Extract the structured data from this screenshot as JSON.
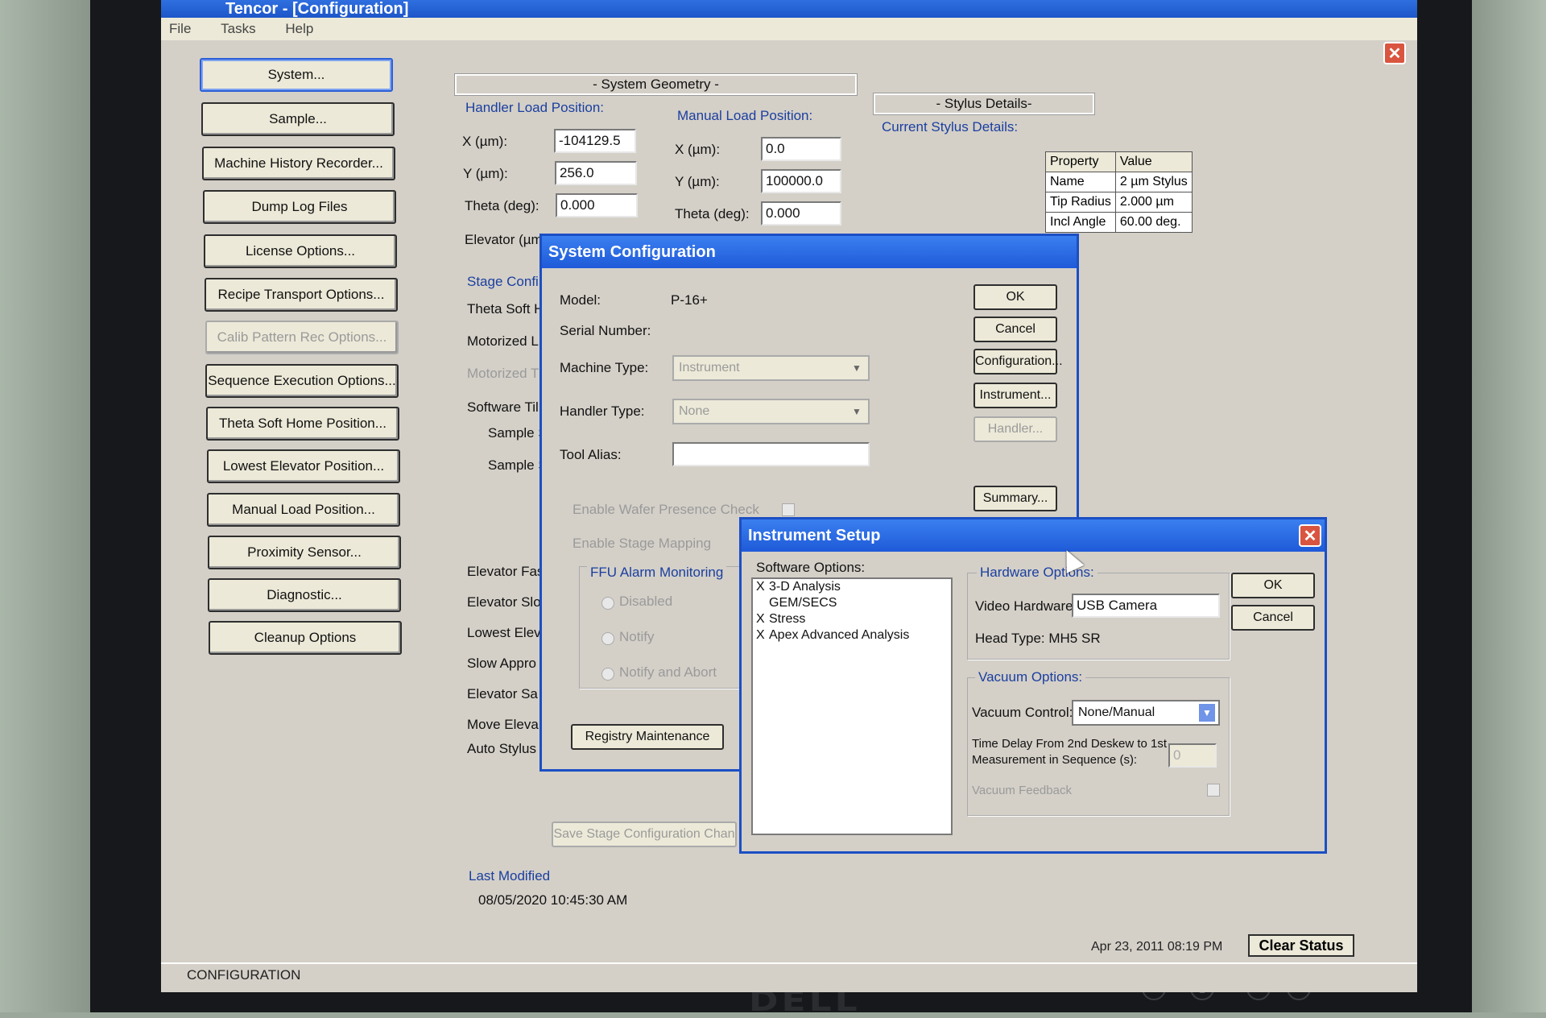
{
  "window": {
    "title": "Tencor - [Configuration]",
    "close": "✕"
  },
  "menu": [
    "File",
    "Tasks",
    "Help"
  ],
  "nav": [
    {
      "label": "System...",
      "state": "active"
    },
    {
      "label": "Sample...",
      "state": "normal"
    },
    {
      "label": "Machine History Recorder...",
      "state": "normal"
    },
    {
      "label": "Dump Log Files",
      "state": "normal"
    },
    {
      "label": "License Options...",
      "state": "normal"
    },
    {
      "label": "Recipe Transport Options...",
      "state": "normal"
    },
    {
      "label": "Calib Pattern Rec Options...",
      "state": "disabled"
    },
    {
      "label": "Sequence Execution Options...",
      "state": "normal"
    },
    {
      "label": "Theta Soft Home Position...",
      "state": "normal"
    },
    {
      "label": "Lowest Elevator Position...",
      "state": "normal"
    },
    {
      "label": "Manual Load Position...",
      "state": "normal"
    },
    {
      "label": "Proximity Sensor...",
      "state": "normal"
    },
    {
      "label": "Diagnostic...",
      "state": "normal"
    },
    {
      "label": "Cleanup Options",
      "state": "normal"
    }
  ],
  "geometry": {
    "title": "- System Geometry -",
    "handler": {
      "title": "Handler Load Position:",
      "x_label": "X (µm):",
      "x": "-104129.5",
      "y_label": "Y (µm):",
      "y": "256.0",
      "theta_label": "Theta (deg):",
      "theta": "0.000",
      "elev_label": "Elevator (µm"
    },
    "manual": {
      "title": "Manual Load Position:",
      "x_label": "X (µm):",
      "x": "0.0",
      "y_label": "Y (µm):",
      "y": "100000.0",
      "theta_label": "Theta (deg):",
      "theta": "0.000"
    }
  },
  "stylus": {
    "title": "- Stylus Details-",
    "current": "Current Stylus Details:",
    "header": [
      "Property",
      "Value"
    ],
    "rows": [
      [
        "Name",
        "2 µm Stylus"
      ],
      [
        "Tip Radius",
        "2.000 µm"
      ],
      [
        "Incl Angle",
        "60.00 deg."
      ]
    ]
  },
  "stage": {
    "title": "Stage Confi",
    "labels": [
      "Theta Soft H",
      "Motorized L",
      "Motorized T",
      "Software Til",
      "Sample S",
      "Sample S",
      "Elevator Fas",
      "Elevator Slo",
      "Lowest Elev",
      "Slow Appro",
      "Elevator Sa",
      "Move Eleva",
      "Auto Stylus"
    ],
    "save_btn": "Save Stage Configuration Chan",
    "last_modified_title": "Last Modified",
    "last_modified": "08/05/2020 10:45:30 AM"
  },
  "sysconfig": {
    "title": "System Configuration",
    "model_label": "Model:",
    "model": "P-16+",
    "serial_label": "Serial Number:",
    "machine_label": "Machine Type:",
    "machine": "Instrument",
    "handler_label": "Handler Type:",
    "handler": "None",
    "alias_label": "Tool Alias:",
    "wafer_check": "Enable Wafer Presence Check",
    "stage_map": "Enable Stage Mapping",
    "ffu_title": "FFU Alarm Monitoring",
    "ffu_opts": [
      "Disabled",
      "Notify",
      "Notify and Abort"
    ],
    "registry_btn": "Registry Maintenance",
    "buttons": [
      "OK",
      "Cancel",
      "Configuration...",
      "Instrument...",
      "Handler...",
      "Summary..."
    ]
  },
  "instrument": {
    "title": "Instrument Setup",
    "sw_title": "Software Options:",
    "sw_items": [
      {
        "mark": "X",
        "text": "3-D Analysis"
      },
      {
        "mark": "",
        "text": "GEM/SECS"
      },
      {
        "mark": "X",
        "text": "Stress"
      },
      {
        "mark": "X",
        "text": "Apex Advanced Analysis"
      }
    ],
    "hw_title": "Hardware Options:",
    "video_label": "Video Hardware:",
    "video": "USB Camera",
    "head": "Head Type: MH5 SR",
    "vac_title": "Vacuum Options:",
    "vac_label": "Vacuum Control:",
    "vac": "None/Manual",
    "delay_label1": "Time Delay From 2nd Deskew to 1st",
    "delay_label2": "Measurement in Sequence (s):",
    "delay": "0",
    "vac_feedback": "Vacuum Feedback",
    "ok": "OK",
    "cancel": "Cancel"
  },
  "status": {
    "text": "CONFIGURATION",
    "date": "Apr 23, 2011 08:19 PM",
    "clear": "Clear Status"
  },
  "monitor": {
    "brand": "DELL"
  }
}
